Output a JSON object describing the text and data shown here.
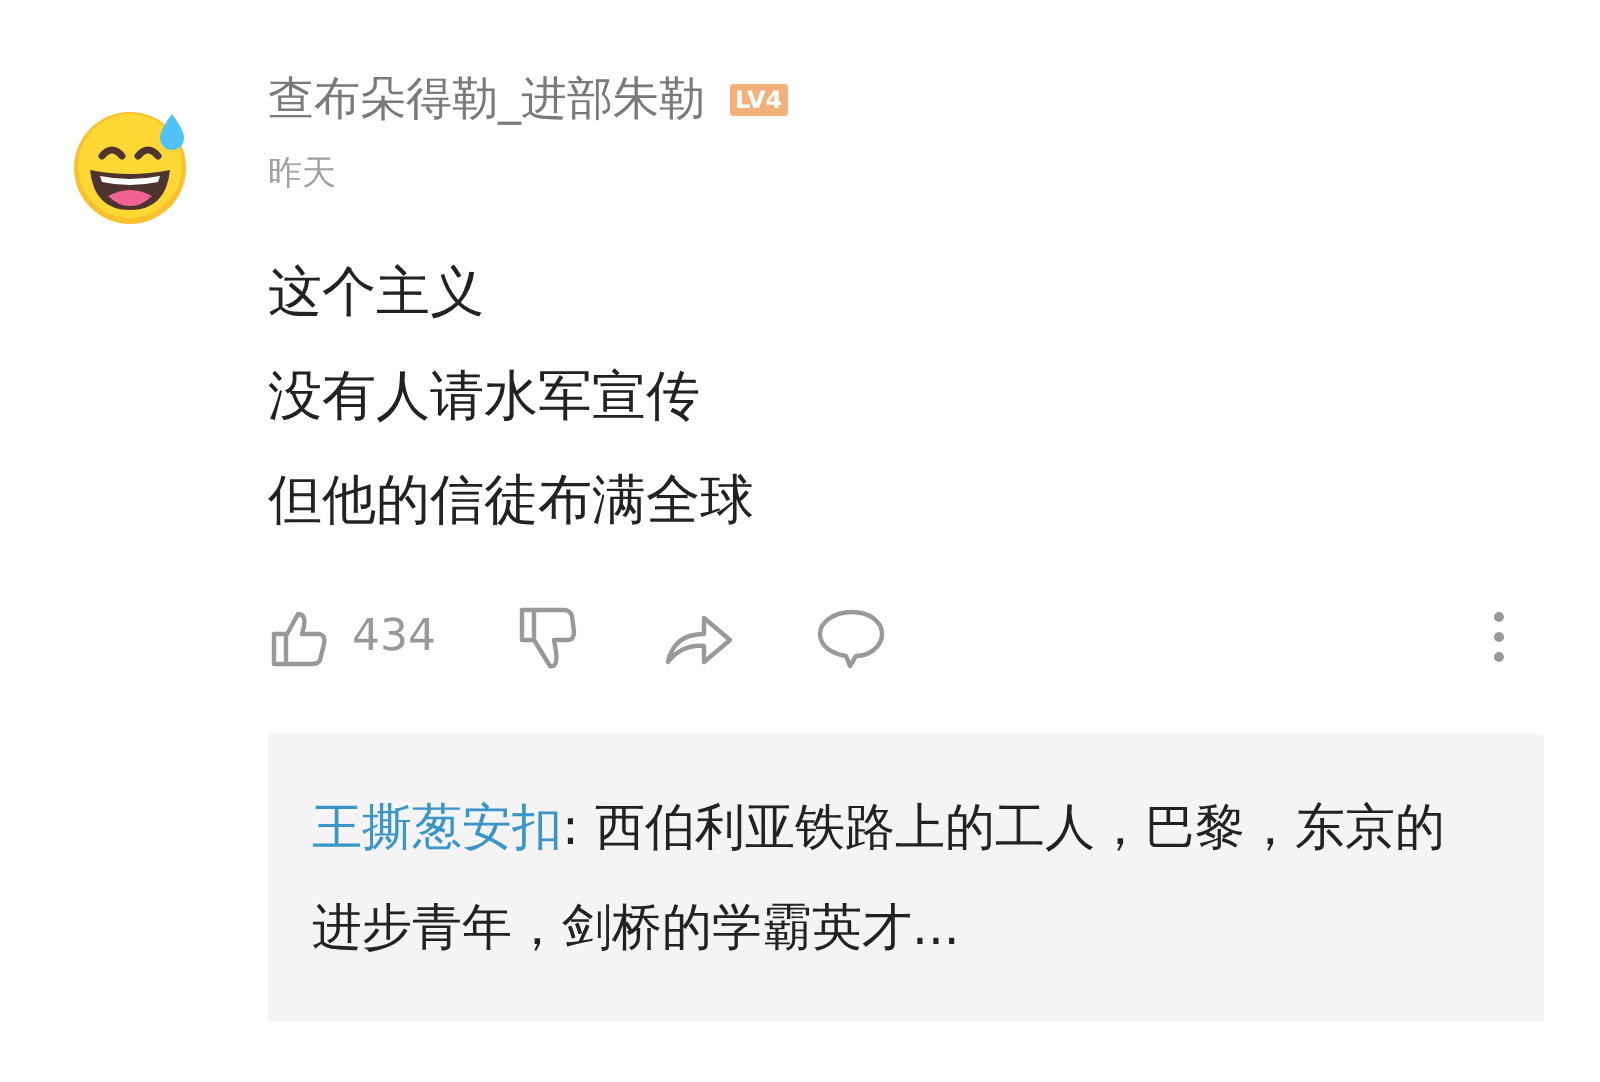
{
  "comment": {
    "author": "查布朵得勒_进部朱勒",
    "level_badge": "LV4",
    "time": "昨天",
    "lines": [
      "这个主义",
      "没有人请水军宣传",
      "但他的信徒布满全球"
    ],
    "actions": {
      "like_count": "434"
    },
    "reply_preview": {
      "author": "王撕葱安扣",
      "separator": ": ",
      "text": "西伯利亚铁路上的工人，巴黎，东京的进步青年，剑桥的学霸英才..."
    }
  }
}
